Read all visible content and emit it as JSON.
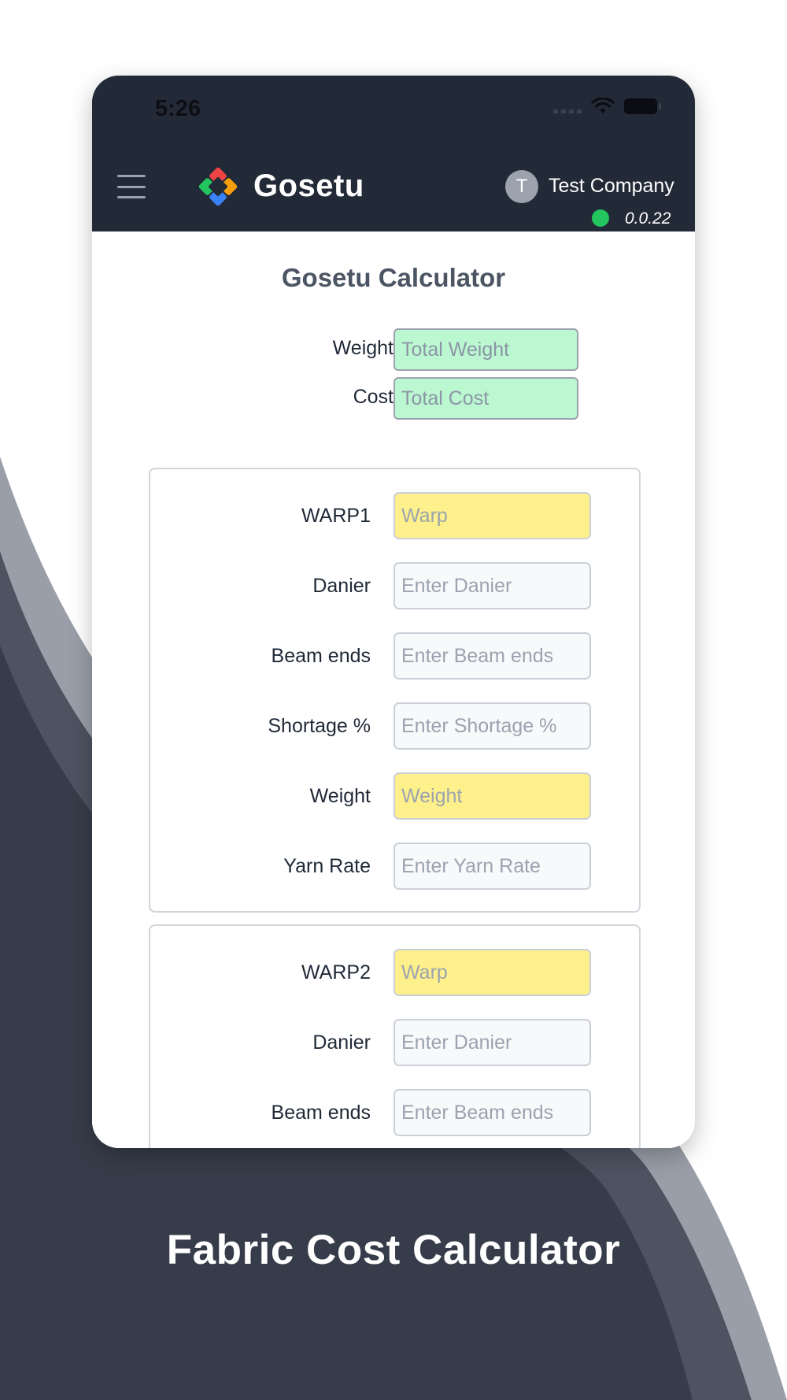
{
  "status_bar": {
    "time": "5:26"
  },
  "header": {
    "brand": "Gosetu",
    "avatar_initial": "T",
    "company": "Test Company",
    "version": "0.0.22"
  },
  "calculator": {
    "title": "Gosetu Calculator",
    "summary": {
      "weight_label": "Weight",
      "weight_placeholder": "Total Weight",
      "cost_label": "Cost",
      "cost_placeholder": "Total Cost"
    },
    "sections": [
      {
        "rows": [
          {
            "label": "WARP1",
            "placeholder": "Warp"
          },
          {
            "label": "Danier",
            "placeholder": "Enter Danier"
          },
          {
            "label": "Beam ends",
            "placeholder": "Enter Beam ends"
          },
          {
            "label": "Shortage %",
            "placeholder": "Enter Shortage %"
          },
          {
            "label": "Weight",
            "placeholder": "Weight"
          },
          {
            "label": "Yarn Rate",
            "placeholder": "Enter Yarn Rate"
          }
        ]
      },
      {
        "rows": [
          {
            "label": "WARP2",
            "placeholder": "Warp"
          },
          {
            "label": "Danier",
            "placeholder": "Enter Danier"
          },
          {
            "label": "Beam ends",
            "placeholder": "Enter Beam ends"
          }
        ]
      }
    ]
  },
  "tagline": "Fabric Cost Calculator",
  "colors": {
    "header_bg": "#222937",
    "summary_field_bg": "#bbf7d0",
    "computed_field_bg": "#fef08a",
    "online_dot": "#22c55e",
    "backdrop": "#363c49"
  },
  "icons": [
    "menu-icon",
    "gosetu-logo",
    "wifi-icon",
    "battery-icon",
    "signal-icon"
  ]
}
